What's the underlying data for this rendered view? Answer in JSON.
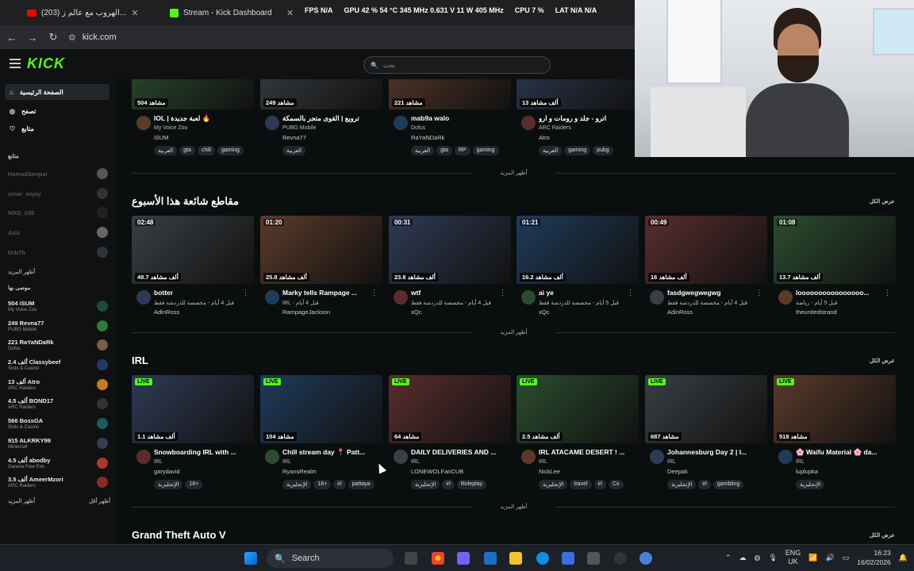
{
  "browser": {
    "tabs": [
      {
        "title": "(203) الهروب مع عالم ز..."
      },
      {
        "title": "Stream - Kick Dashboard"
      }
    ],
    "overlay": {
      "fps": "FPS N/A",
      "gpu": "GPU 42 % 54 °C 345 MHz 0.631 V 11 W 405 MHz",
      "cpu": "CPU 7 %",
      "lat": "LAT N/A N/A"
    },
    "url": "kick.com"
  },
  "header": {
    "logo": "KICK",
    "search_placeholder": "بحث"
  },
  "sidebar": {
    "nav": [
      {
        "label": "الصفحة الرئيسية"
      },
      {
        "label": "تصفح"
      },
      {
        "label": "متابع"
      }
    ],
    "following_heading": "متابع",
    "following": [
      {
        "name": "HamadSenpai"
      },
      {
        "name": "omar_enjoy"
      },
      {
        "name": "MXD_030"
      },
      {
        "name": "Aziz"
      },
      {
        "name": "Drb7h"
      }
    ],
    "show_more_1": "أظهر المزيد",
    "recommended_heading": "موصى بها",
    "recommended": [
      {
        "count": "504",
        "name": "iSUM",
        "category": "My Voice Zoo"
      },
      {
        "count": "249",
        "name": "Revna77",
        "category": "PUBG Mobile"
      },
      {
        "count": "221",
        "name": "RaYaNDaRk",
        "category": "Dofus"
      },
      {
        "count": "2.4 ألف",
        "name": "Classybeef",
        "category": "Slots & Casino"
      },
      {
        "count": "13 ألف",
        "name": "Atro",
        "category": "ARC Raiders"
      },
      {
        "count": "4.5 ألف",
        "name": "BOND17",
        "category": "ARC Raiders"
      },
      {
        "count": "566",
        "name": "BossGA",
        "category": "Slots & Casino"
      },
      {
        "count": "915",
        "name": "ALKRKY99",
        "category": "Minecraft"
      },
      {
        "count": "4.5 ألف",
        "name": "abodby",
        "category": "Garena Free Fire"
      },
      {
        "count": "3.5 ألف",
        "name": "AmeerMzori",
        "category": "ARC Raiders"
      }
    ],
    "show_more_2": "أظهر المزيد",
    "show_less": "أظهر أقل"
  },
  "row1": [
    {
      "viewers": "504 مشاهد",
      "title": "IOL | لعبة جديدة 🔥",
      "category": "My Voice Zoo",
      "channel": "iSUM",
      "tags": [
        "العربية",
        "gta",
        "chill",
        "gaming"
      ]
    },
    {
      "viewers": "249 مشاهد",
      "title": "ترويع | القوى متجر بالسمكة",
      "category": "PUBG Mobile",
      "channel": "Revna77",
      "tags": [
        "العربية"
      ]
    },
    {
      "viewers": "221 مشاهد",
      "title": "mab9a walo",
      "category": "Dofus",
      "channel": "RaYaNDaRk",
      "tags": [
        "العربية",
        "gta",
        "RP",
        "gaming"
      ]
    },
    {
      "viewers": "13 ألف مشاهد",
      "title": "اترو - جلد و رومات و ارو",
      "category": "ARC Raiders",
      "channel": "Atro",
      "tags": [
        "العربية",
        "gaming",
        "pubg"
      ]
    }
  ],
  "row1_show_more": "أظهر المزيد",
  "clips": {
    "title": "مقاطع شائعة هذا الأسبوع",
    "see_all": "عرض الكل",
    "show_more": "أظهر المزيد",
    "items": [
      {
        "duration": "02:48",
        "viewers": "49.7 ألف مشاهد",
        "title": "botter",
        "meta": "قبل 4 أيام - مخصصة للدردشة فقط",
        "channel": "AdinRoss"
      },
      {
        "duration": "01:20",
        "viewers": "25.8 ألف مشاهد",
        "title": "Marky tells Rampage ...",
        "meta": "IRL - قبل 4 أيام",
        "channel": "RampageJackson"
      },
      {
        "duration": "00:31",
        "viewers": "23.8 ألف مشاهد",
        "title": "wtf",
        "meta": "قبل 4 أيام - مخصصة للدردشة فقط",
        "channel": "xQc"
      },
      {
        "duration": "01:21",
        "viewers": "16.2 ألف مشاهد",
        "title": "ai ye",
        "meta": "قبل 5 أيام - مخصصة للدردشة فقط",
        "channel": "xQc"
      },
      {
        "duration": "00:49",
        "viewers": "16 ألف مشاهد",
        "title": "fasdgwegwegwg",
        "meta": "قبل 4 أيام - مخصصة للدردشة فقط",
        "channel": "AdinRoss"
      },
      {
        "duration": "01:08",
        "viewers": "13.7 ألف مشاهد",
        "title": "loooooooooooooooo...",
        "meta": "قبل 5 أيام - رياضة",
        "channel": "theunitedstrand"
      }
    ]
  },
  "irl": {
    "title": "IRL",
    "see_all": "عرض الكل",
    "show_more": "أظهر المزيد",
    "live_label": "LIVE",
    "items": [
      {
        "viewers": "1.1 ألف مشاهد",
        "title": "Snowboarding IRL with ...",
        "category": "IRL",
        "channel": "garydavid",
        "tags": [
          "الإنجليزية",
          "18+"
        ]
      },
      {
        "viewers": "104 مشاهد",
        "title": "Chill stream day 📍 Patt...",
        "category": "IRL",
        "channel": "RyansRealm",
        "tags": [
          "الإنجليزية",
          "18+",
          "irl",
          "pattaya"
        ]
      },
      {
        "viewers": "64 مشاهد",
        "title": "DAILY DELIVERIES AND ...",
        "category": "IRL",
        "channel": "LONEWOLFanCUB",
        "tags": [
          "الإنجليزية",
          "irl",
          "Roleplay"
        ]
      },
      {
        "viewers": "2.5 ألف مشاهد",
        "title": "IRL ATACAME DESERT ! ...",
        "category": "IRL",
        "channel": "NickLee",
        "tags": [
          "الإنجليزية",
          "travel",
          "irl",
          "Cx"
        ]
      },
      {
        "viewers": "687 مشاهد",
        "title": "Johannesburg Day 2 | I...",
        "category": "IRL",
        "channel": "Deepak",
        "tags": [
          "الإنجليزية",
          "irl",
          "gambling"
        ]
      },
      {
        "viewers": "518 مشاهد",
        "title": "🌸 Waifu Material 🌸 da...",
        "category": "IRL",
        "channel": "luplupka",
        "tags": [
          "الإنجليزية"
        ]
      }
    ]
  },
  "gta": {
    "title": "Grand Theft Auto V",
    "see_all": "عرض الكل"
  },
  "taskbar": {
    "search": "Search",
    "lang1": "ENG",
    "lang2": "UK",
    "time": "16:23",
    "date": "16/02/2026"
  }
}
